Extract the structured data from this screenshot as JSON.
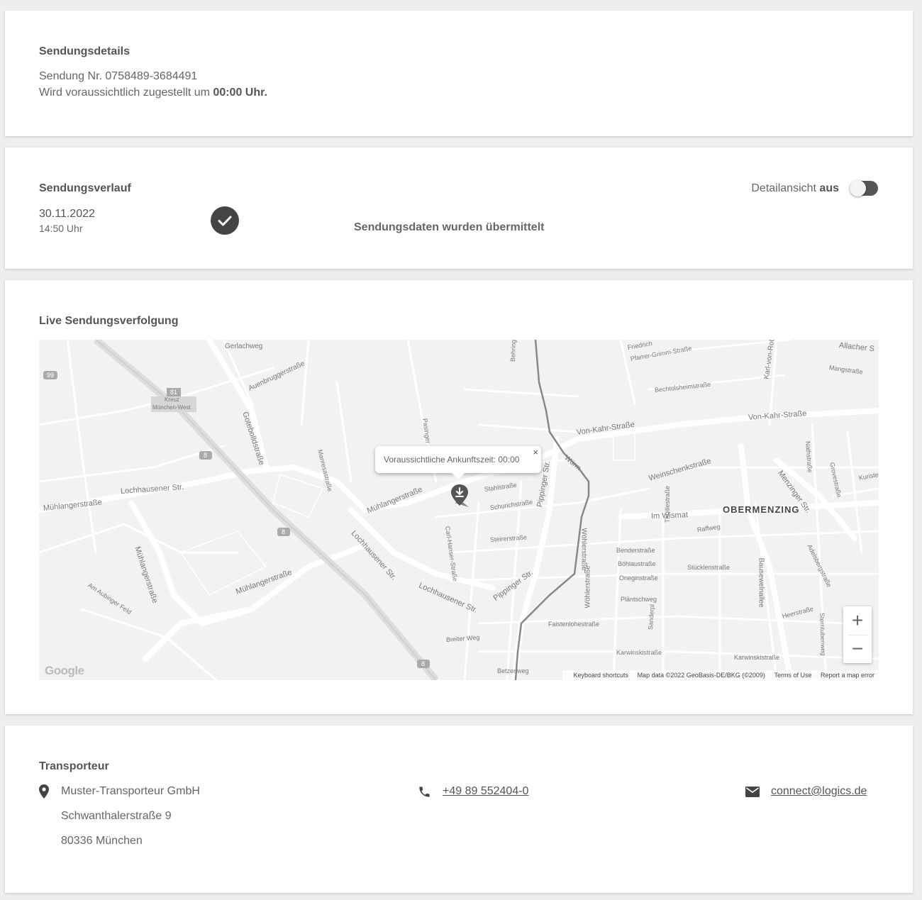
{
  "details": {
    "title": "Sendungsdetails",
    "shipment_label": "Sendung Nr.",
    "shipment_number": "0758489-3684491",
    "eta_prefix": "Wird voraussichtlich zugestellt um",
    "eta_time": "00:00 Uhr."
  },
  "history": {
    "title": "Sendungsverlauf",
    "toggle_label": "Detailansicht",
    "toggle_state": "aus",
    "entries": [
      {
        "date": "30.11.2022",
        "time": "14:50 Uhr",
        "status": "Sendungsdaten wurden übermittelt"
      }
    ]
  },
  "tracking": {
    "title": "Live Sendungsverfolgung",
    "popup_text": "Voraussichtliche Ankunftszeit: 00:00",
    "popup_close": "×",
    "zoom_in": "+",
    "zoom_out": "−",
    "google_logo": "Google",
    "attribution": {
      "shortcuts": "Keyboard shortcuts",
      "map_data": "Map data ©2022 GeoBasis-DE/BKG (©2009)",
      "terms": "Terms of Use",
      "report": "Report a map error"
    },
    "district": "OBERMENZING",
    "streets": [
      "Gerlachweg",
      "Auenbruggerstraße",
      "Gotebolldstraße",
      "Lochhausener Str.",
      "Mühlangerstraße",
      "Mühlangerstraße",
      "Mühlangerstraße",
      "Mühlangerstraße",
      "Lochhausener Str.",
      "Lochhausener Str.",
      "Manresastraße",
      "Pasinger",
      "Carl-Hanser-Straße",
      "Stahlstraße",
      "Schurichstraße",
      "Steirerstraße",
      "Breiter Weg",
      "Pippinger Str.",
      "Pippinger Str.",
      "Von-Kahr-Straße",
      "Von-Kahr-Straße",
      "Weinschenkstraße",
      "Im Wismat",
      "Raffweg",
      "Benderstraße",
      "Böhlaustraße",
      "Oneginstraße",
      "Pläntschweg",
      "Faistenlohestraße",
      "Karwinskistraße",
      "Karwinskistraße",
      "Wöhlerstraße",
      "Wöhlerstraße",
      "Thuillestraße",
      "Stücklenstraße",
      "Bausewelnallee",
      "Heerstraße",
      "Menzinger Str.",
      "Adelsbergstraße",
      "Sterntubenweg",
      "Friedrich",
      "Pfarrer-Grimm-Straße",
      "Bechtolsheimstraße",
      "Karl-von-Roth-Str",
      "Mangstraße",
      "Allacher S",
      "Nathstraße",
      "Grovestraße",
      "Kuriste",
      "Am Aubinger Feld",
      "Betzenweg",
      "Behringstr",
      "Würm",
      "Sanderpl"
    ],
    "road_badges": [
      "99",
      "8",
      "8",
      "8",
      "81"
    ],
    "junction": {
      "line1": "Kreuz",
      "line2": "München-West"
    }
  },
  "carrier": {
    "title": "Transporteur",
    "name": "Muster-Transporteur GmbH",
    "street": "Schwanthalerstraße 9",
    "city": "80336 München",
    "phone": "+49 89 552404-0",
    "email": "connect@logics.de"
  },
  "icons": {
    "check": "check-icon",
    "location": "location-pin-icon",
    "phone": "phone-icon",
    "email": "envelope-icon",
    "marker": "delivery-marker-icon"
  },
  "colors": {
    "accent": "#444444",
    "map_bg": "#f2f2f2",
    "card_bg": "#ffffff",
    "page_bg": "#eeeeee"
  }
}
